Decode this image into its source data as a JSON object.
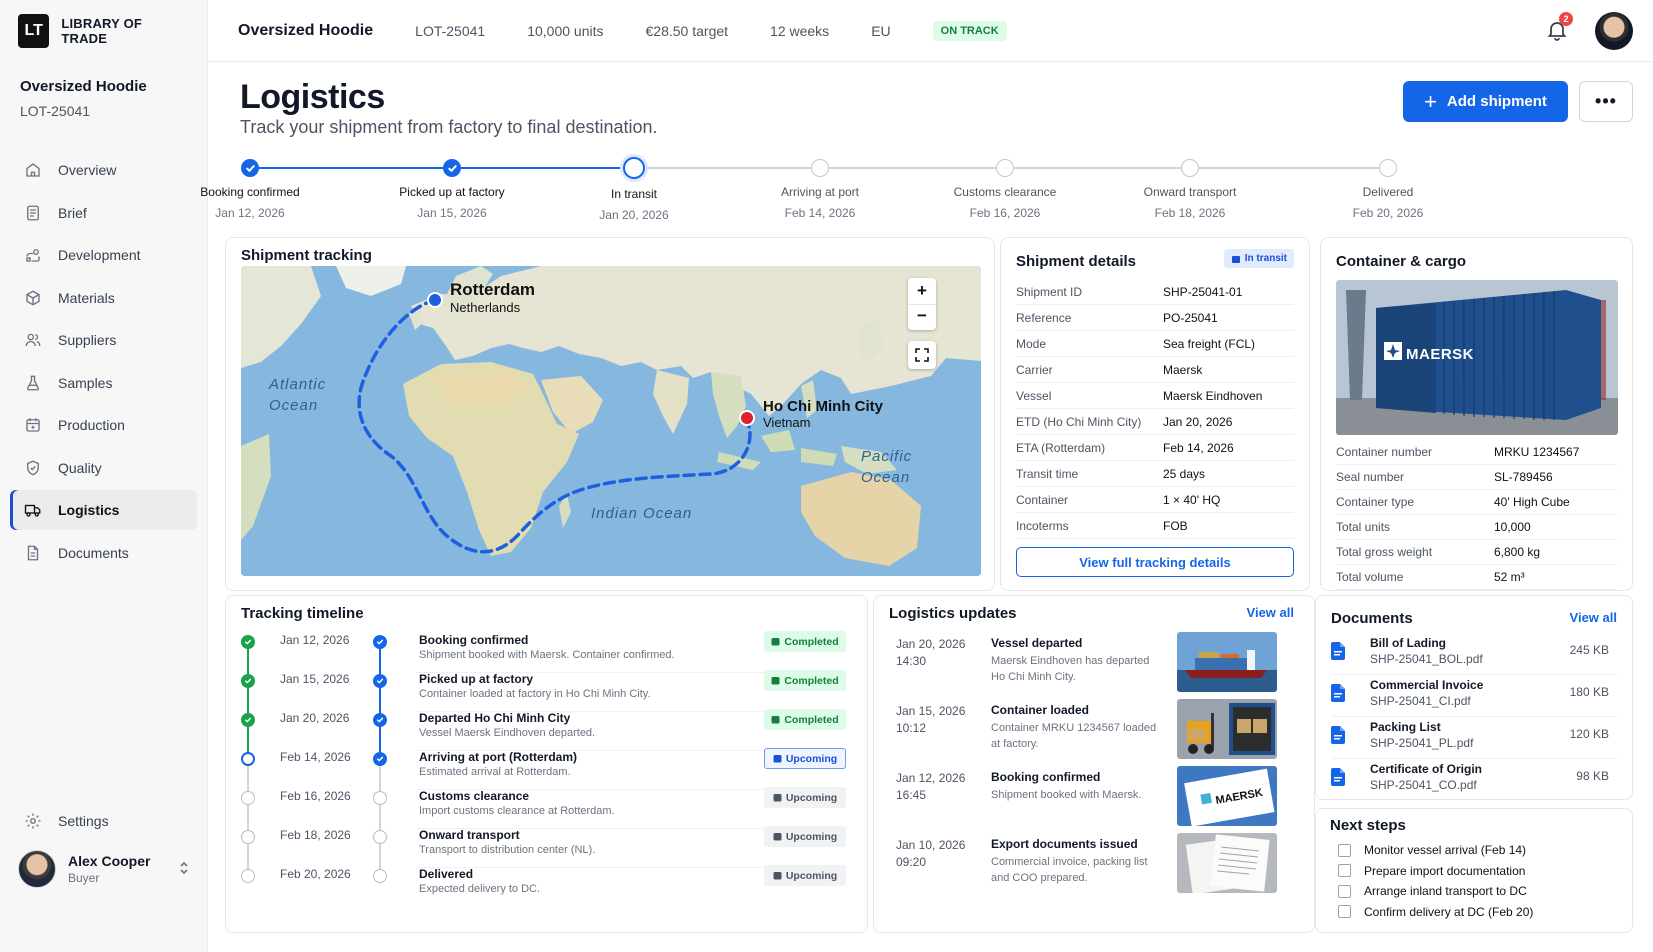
{
  "brand": {
    "logo": "LT",
    "name": "LIBRARY OF TRADE"
  },
  "project": {
    "name": "Oversized Hoodie",
    "lot": "LOT-25041"
  },
  "sidebar": {
    "items": [
      {
        "label": "Overview",
        "icon": "home-icon"
      },
      {
        "label": "Brief",
        "icon": "brief-icon"
      },
      {
        "label": "Development",
        "icon": "development-icon"
      },
      {
        "label": "Materials",
        "icon": "materials-icon"
      },
      {
        "label": "Suppliers",
        "icon": "suppliers-icon"
      },
      {
        "label": "Samples",
        "icon": "samples-icon"
      },
      {
        "label": "Production",
        "icon": "production-icon"
      },
      {
        "label": "Quality",
        "icon": "quality-icon"
      },
      {
        "label": "Logistics",
        "icon": "truck-icon"
      },
      {
        "label": "Documents",
        "icon": "document-icon"
      }
    ],
    "active": "Logistics",
    "settings": "Settings"
  },
  "user": {
    "name": "Alex Cooper",
    "role": "Buyer"
  },
  "topbar": {
    "title": "Oversized Hoodie",
    "lot": "LOT-25041",
    "units": "10,000 units",
    "target": "€28.50 target",
    "weeks": "12 weeks",
    "region": "EU",
    "status": "ON TRACK",
    "notifications": "2"
  },
  "header": {
    "title": "Logistics",
    "subtitle": "Track your shipment from factory to final destination.",
    "add_button": "Add shipment",
    "more_button": "•••"
  },
  "stepper": [
    {
      "label": "Booking confirmed",
      "date": "Jan 12, 2026",
      "state": "done"
    },
    {
      "label": "Picked up at factory",
      "date": "Jan 15, 2026",
      "state": "done"
    },
    {
      "label": "In transit",
      "date": "Jan 20, 2026",
      "state": "current"
    },
    {
      "label": "Arriving at port",
      "date": "Feb 14, 2026",
      "state": "todo"
    },
    {
      "label": "Customs clearance",
      "date": "Feb 16, 2026",
      "state": "todo"
    },
    {
      "label": "Onward transport",
      "date": "Feb 18, 2026",
      "state": "todo"
    },
    {
      "label": "Delivered",
      "date": "Feb 20, 2026",
      "state": "todo"
    }
  ],
  "map": {
    "title": "Shipment tracking",
    "origin": {
      "city": "Ho Chi Minh City",
      "country": "Vietnam"
    },
    "destination": {
      "city": "Rotterdam",
      "country": "Netherlands"
    },
    "labels": {
      "atlantic": "Atlantic Ocean",
      "pacific": "Pacific Ocean",
      "indian": "Indian Ocean"
    },
    "zoom_in": "+",
    "zoom_out": "−"
  },
  "shipment": {
    "title": "Shipment details",
    "status": "In transit",
    "rows": [
      {
        "k": "Shipment ID",
        "v": "SHP-25041-01"
      },
      {
        "k": "Reference",
        "v": "PO-25041"
      },
      {
        "k": "Mode",
        "v": "Sea freight (FCL)"
      },
      {
        "k": "Carrier",
        "v": "Maersk"
      },
      {
        "k": "Vessel",
        "v": "Maersk Eindhoven"
      },
      {
        "k": "ETD (Ho Chi Minh City)",
        "v": "Jan 20, 2026"
      },
      {
        "k": "ETA (Rotterdam)",
        "v": "Feb 14, 2026"
      },
      {
        "k": "Transit time",
        "v": "25 days"
      },
      {
        "k": "Container",
        "v": "1 × 40' HQ"
      },
      {
        "k": "Incoterms",
        "v": "FOB"
      }
    ],
    "button": "View full tracking details"
  },
  "container": {
    "title": "Container & cargo",
    "image_text": "MAERSK",
    "rows": [
      {
        "k": "Container number",
        "v": "MRKU 1234567"
      },
      {
        "k": "Seal number",
        "v": "SL-789456"
      },
      {
        "k": "Container type",
        "v": "40' High Cube"
      },
      {
        "k": "Total units",
        "v": "10,000"
      },
      {
        "k": "Total gross weight",
        "v": "6,800 kg"
      },
      {
        "k": "Total volume",
        "v": "52 m³"
      }
    ]
  },
  "timeline": {
    "title": "Tracking timeline",
    "rows": [
      {
        "date": "Jan 12, 2026",
        "title": "Booking confirmed",
        "desc": "Shipment booked with Maersk. Container confirmed.",
        "status": "Completed",
        "left": "green",
        "right": "blue"
      },
      {
        "date": "Jan 15, 2026",
        "title": "Picked up at factory",
        "desc": "Container loaded at factory in Ho Chi Minh City.",
        "status": "Completed",
        "left": "green",
        "right": "blue"
      },
      {
        "date": "Jan 20, 2026",
        "title": "Departed Ho Chi Minh City",
        "desc": "Vessel Maersk Eindhoven departed.",
        "status": "Completed",
        "left": "green",
        "right": "blue"
      },
      {
        "date": "Feb 14, 2026",
        "title": "Arriving at port (Rotterdam)",
        "desc": "Estimated arrival at Rotterdam.",
        "status": "Upcoming",
        "left": "ring",
        "right": "blue"
      },
      {
        "date": "Feb 16, 2026",
        "title": "Customs clearance",
        "desc": "Import customs clearance at Rotterdam.",
        "status": "Upcoming",
        "left": "grey",
        "right": "grey"
      },
      {
        "date": "Feb 18, 2026",
        "title": "Onward transport",
        "desc": "Transport to distribution center (NL).",
        "status": "Upcoming",
        "left": "grey",
        "right": "grey"
      },
      {
        "date": "Feb 20, 2026",
        "title": "Delivered",
        "desc": "Expected delivery to DC.",
        "status": "Upcoming",
        "left": "grey",
        "right": "grey"
      }
    ]
  },
  "updates": {
    "title": "Logistics updates",
    "view_all": "View all",
    "rows": [
      {
        "date": "Jan 20, 2026",
        "time": "14:30",
        "title": "Vessel departed",
        "desc": "Maersk Eindhoven has departed Ho Chi Minh City.",
        "thumb": "vessel"
      },
      {
        "date": "Jan 15, 2026",
        "time": "10:12",
        "title": "Container loaded",
        "desc": "Container MRKU 1234567 loaded at factory.",
        "thumb": "forklift"
      },
      {
        "date": "Jan 12, 2026",
        "time": "16:45",
        "title": "Booking confirmed",
        "desc": "Shipment booked with Maersk.",
        "thumb": "maersk"
      },
      {
        "date": "Jan 10, 2026",
        "time": "09:20",
        "title": "Export documents issued",
        "desc": "Commercial invoice, packing list and COO prepared.",
        "thumb": "paper"
      }
    ]
  },
  "documents": {
    "title": "Documents",
    "view_all": "View all",
    "rows": [
      {
        "name": "Bill of Lading",
        "file": "SHP-25041_BOL.pdf",
        "size": "245 KB"
      },
      {
        "name": "Commercial Invoice",
        "file": "SHP-25041_CI.pdf",
        "size": "180 KB"
      },
      {
        "name": "Packing List",
        "file": "SHP-25041_PL.pdf",
        "size": "120 KB"
      },
      {
        "name": "Certificate of Origin",
        "file": "SHP-25041_CO.pdf",
        "size": "98 KB"
      }
    ]
  },
  "next_steps": {
    "title": "Next steps",
    "items": [
      "Monitor vessel arrival (Feb 14)",
      "Prepare import documentation",
      "Arrange inland transport to DC",
      "Confirm delivery at DC (Feb 20)"
    ]
  },
  "colors": {
    "accent": "#1565e8",
    "success": "#16a34a",
    "danger": "#e11d2e"
  }
}
